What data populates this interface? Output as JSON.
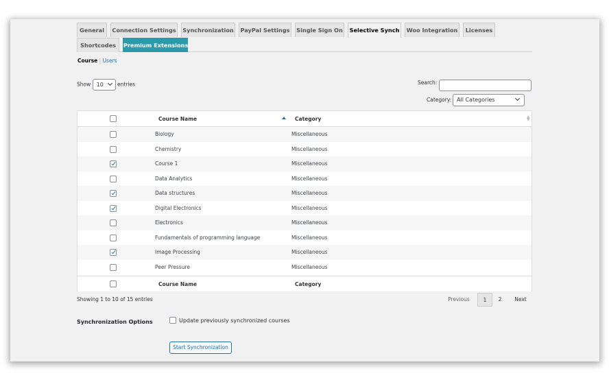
{
  "tabs": [
    {
      "label": "General"
    },
    {
      "label": "Connection Settings"
    },
    {
      "label": "Synchronization"
    },
    {
      "label": "PayPal Settings"
    },
    {
      "label": "Single Sign On"
    },
    {
      "label": "Selective Synch",
      "active": true
    },
    {
      "label": "Woo Integration"
    },
    {
      "label": "Licenses"
    },
    {
      "label": "Shortcodes"
    },
    {
      "label": "Premium Extensions"
    }
  ],
  "subnav": {
    "course": "Course",
    "separator": "|",
    "users": "Users"
  },
  "length": {
    "show": "Show",
    "value": "10",
    "entries": "entries"
  },
  "search": {
    "label": "Search:",
    "value": ""
  },
  "category_filter": {
    "label": "Category:",
    "value": "All Categories"
  },
  "table": {
    "columns": [
      "Course Name",
      "Category"
    ],
    "rows": [
      {
        "name": "Biology",
        "category": "Miscellaneous",
        "checked": false
      },
      {
        "name": "Chemistry",
        "category": "Miscellaneous",
        "checked": false
      },
      {
        "name": "Course 1",
        "category": "Miscellaneous",
        "checked": true
      },
      {
        "name": "Data Analytics",
        "category": "Miscellaneous",
        "checked": false
      },
      {
        "name": "Data structures",
        "category": "Miscellaneous",
        "checked": true
      },
      {
        "name": "Digital Electronics",
        "category": "Miscellaneous",
        "checked": true
      },
      {
        "name": "Electronics",
        "category": "Miscellaneous",
        "checked": false
      },
      {
        "name": "Fundamentals of programming language",
        "category": "Miscellaneous",
        "checked": false
      },
      {
        "name": "Image Processing",
        "category": "Miscellaneous",
        "checked": true
      },
      {
        "name": "Peer Pressure",
        "category": "Miscellaneous",
        "checked": false
      }
    ]
  },
  "info": "Showing 1 to 10 of 15 entries",
  "pagination": {
    "previous": "Previous",
    "current": "1",
    "page2": "2",
    "next": "Next"
  },
  "sync": {
    "title": "Synchronization Options",
    "update_label": "Update previously synchronized courses",
    "update_checked": false,
    "start_button": "Start Synchronization"
  },
  "colors": {
    "accent": "#2b9bab",
    "link": "#2271b1"
  }
}
